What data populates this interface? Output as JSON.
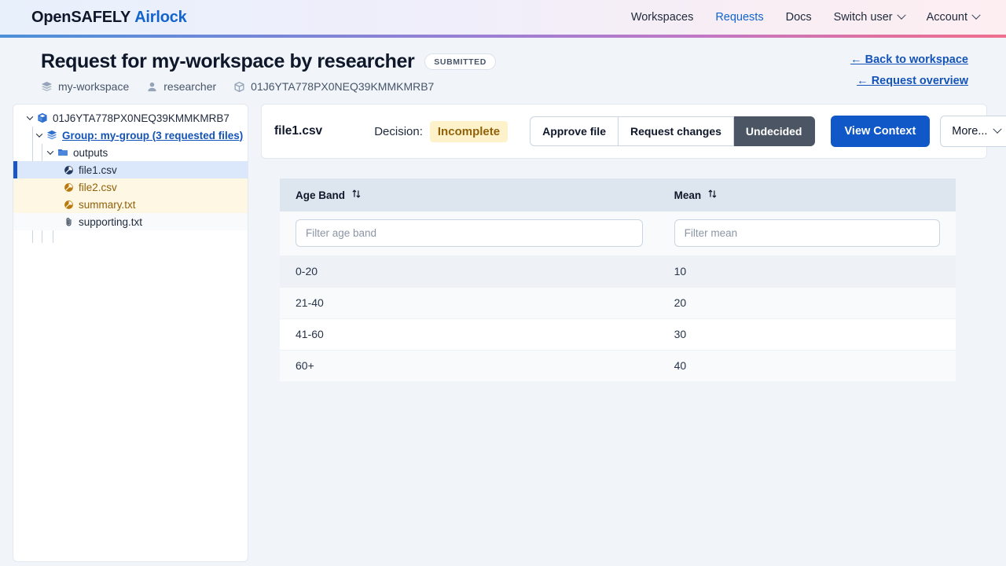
{
  "nav": {
    "brand_primary": "OpenSAFELY",
    "brand_secondary": "Airlock",
    "links": [
      {
        "label": "Workspaces",
        "active": false,
        "dropdown": false
      },
      {
        "label": "Requests",
        "active": true,
        "dropdown": false
      },
      {
        "label": "Docs",
        "active": false,
        "dropdown": false
      },
      {
        "label": "Switch user",
        "active": false,
        "dropdown": true
      },
      {
        "label": "Account",
        "active": false,
        "dropdown": true
      }
    ]
  },
  "header": {
    "title": "Request for my-workspace by researcher",
    "status_badge": "SUBMITTED",
    "meta": [
      {
        "icon": "layers-icon",
        "label": "my-workspace"
      },
      {
        "icon": "user-icon",
        "label": "researcher"
      },
      {
        "icon": "box-icon",
        "label": "01J6YTA778PX0NEQ39KMMKMRB7"
      }
    ],
    "links": [
      {
        "label": "← Back to workspace"
      },
      {
        "label": "← Request overview"
      }
    ]
  },
  "tree": {
    "root": {
      "label": "01J6YTA778PX0NEQ39KMMKMRB7",
      "icon": "request-box-icon"
    },
    "group": {
      "label": "Group: my-group (3 requested files)",
      "icon": "layers-icon"
    },
    "folder": {
      "label": "outputs",
      "icon": "folder-icon"
    },
    "files": [
      {
        "label": "file1.csv",
        "icon": "csv-file-icon",
        "state": "selected"
      },
      {
        "label": "file2.csv",
        "icon": "csv-file-icon",
        "state": "incomplete"
      },
      {
        "label": "summary.txt",
        "icon": "csv-file-icon",
        "state": "incomplete"
      },
      {
        "label": "supporting.txt",
        "icon": "paperclip-icon",
        "state": "supporting"
      }
    ]
  },
  "decision_bar": {
    "filename": "file1.csv",
    "decision_label": "Decision:",
    "decision_value": "Incomplete",
    "group_buttons": [
      {
        "label": "Approve file",
        "selected": false
      },
      {
        "label": "Request changes",
        "selected": false
      },
      {
        "label": "Undecided",
        "selected": true
      }
    ],
    "primary_button": "View Context",
    "more_button": "More..."
  },
  "table": {
    "columns": [
      {
        "label": "Age Band",
        "sort_icon": "sort-arrows-icon",
        "filter_placeholder": "Filter age band"
      },
      {
        "label": "Mean",
        "sort_icon": "sort-arrows-icon",
        "filter_placeholder": "Filter mean"
      }
    ],
    "rows": [
      {
        "age_band": "0-20",
        "mean": "10"
      },
      {
        "age_band": "21-40",
        "mean": "20"
      },
      {
        "age_band": "41-60",
        "mean": "30"
      },
      {
        "age_band": "60+",
        "mean": "40"
      }
    ]
  },
  "colors": {
    "brand_blue": "#1264cc",
    "primary_button": "#1058c8",
    "selected_toggle": "#4b5563",
    "incomplete_amber": "#92610a",
    "incomplete_amber_bg": "#fdf2c9",
    "tree_selected_bg": "#dbe8fb",
    "tree_incomplete_bg": "#fdf7e3",
    "page_bg": "#f1f5f9"
  }
}
